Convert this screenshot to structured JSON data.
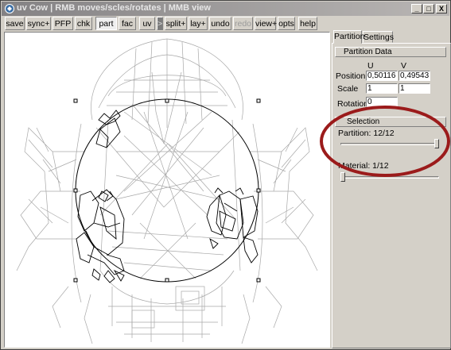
{
  "window": {
    "title": "uv Cow | RMB moves/scles/rotates | MMB view",
    "controls": [
      "_",
      "□",
      "X"
    ]
  },
  "toolbar": [
    {
      "label": "save",
      "state": "normal"
    },
    {
      "label": "sync+",
      "state": "normal"
    },
    {
      "label": "PFP",
      "state": "normal"
    },
    {
      "label": "chk",
      "state": "normal"
    },
    {
      "label": "part",
      "state": "active"
    },
    {
      "label": "fac",
      "state": "normal"
    },
    {
      "label": "uv",
      "state": "normal"
    },
    {
      "label": ">",
      "state": "dark"
    },
    {
      "label": "split+",
      "state": "normal"
    },
    {
      "label": "lay+",
      "state": "normal"
    },
    {
      "label": "undo",
      "state": "normal"
    },
    {
      "label": "redo",
      "state": "disabled"
    },
    {
      "label": "view+",
      "state": "normal"
    },
    {
      "label": "opts",
      "state": "normal"
    },
    {
      "label": "help",
      "state": "normal"
    }
  ],
  "sidebar": {
    "tabs": [
      {
        "label": "Partition",
        "active": true
      },
      {
        "label": "Settings",
        "active": false
      }
    ],
    "partition_data": {
      "heading": "Partition Data",
      "col_u": "U",
      "col_v": "V",
      "position_label": "Position",
      "position_u": "0,50116",
      "position_v": "0,49543",
      "scale_label": "Scale",
      "scale_u": "1",
      "scale_v": "1",
      "rotation_label": "Rotation",
      "rotation": "0"
    },
    "selection": {
      "heading": "Selection",
      "partition_label": "Partition: 12/12",
      "partition_value": 12,
      "partition_max": 12,
      "material_label": "Material: 1/12",
      "material_value": 1,
      "material_max": 12
    }
  },
  "annotation": {
    "highlight_color": "#9b1b1b"
  },
  "colors": {
    "wire_grey": "#a8a8a8",
    "wire_selected": "#000000",
    "panel_bg": "#d4d0c8"
  }
}
